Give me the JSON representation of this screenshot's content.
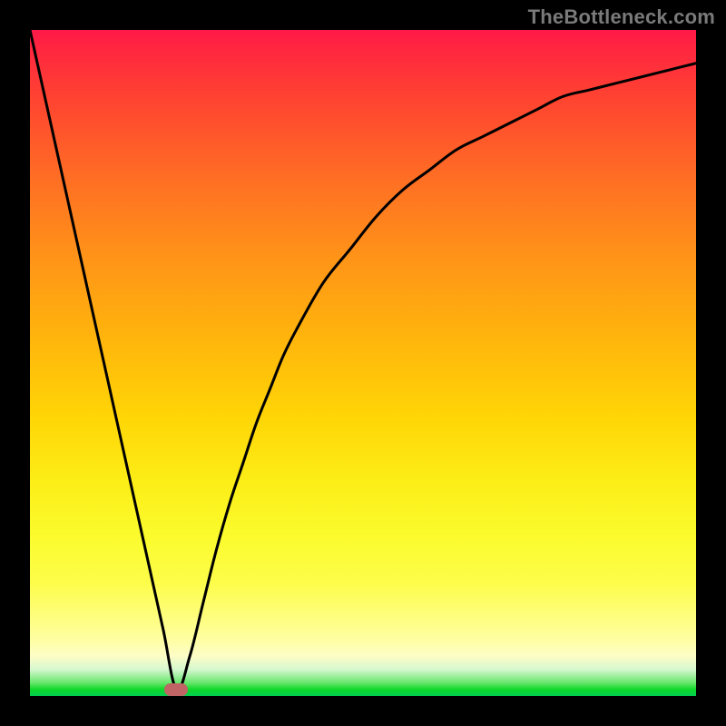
{
  "watermark": "TheBottleneck.com",
  "colors": {
    "frame": "#000000",
    "marker": "#c16465",
    "curve": "#000000"
  },
  "chart_data": {
    "type": "line",
    "title": "",
    "xlabel": "",
    "ylabel": "",
    "xlim": [
      0,
      100
    ],
    "ylim": [
      0,
      100
    ],
    "minimum_at_x": 22,
    "series": [
      {
        "name": "bottleneck-curve",
        "x": [
          0,
          2,
          4,
          6,
          8,
          10,
          12,
          14,
          16,
          18,
          20,
          22,
          24,
          26,
          28,
          30,
          32,
          34,
          36,
          38,
          40,
          44,
          48,
          52,
          56,
          60,
          64,
          68,
          72,
          76,
          80,
          84,
          88,
          92,
          96,
          100
        ],
        "values": [
          100,
          91,
          82,
          73,
          64,
          55,
          46,
          37,
          28,
          19,
          10,
          1,
          6,
          14,
          22,
          29,
          35,
          41,
          46,
          51,
          55,
          62,
          67,
          72,
          76,
          79,
          82,
          84,
          86,
          88,
          90,
          91,
          92,
          93,
          94,
          95
        ]
      }
    ],
    "marker": {
      "x": 22,
      "y": 1
    }
  }
}
